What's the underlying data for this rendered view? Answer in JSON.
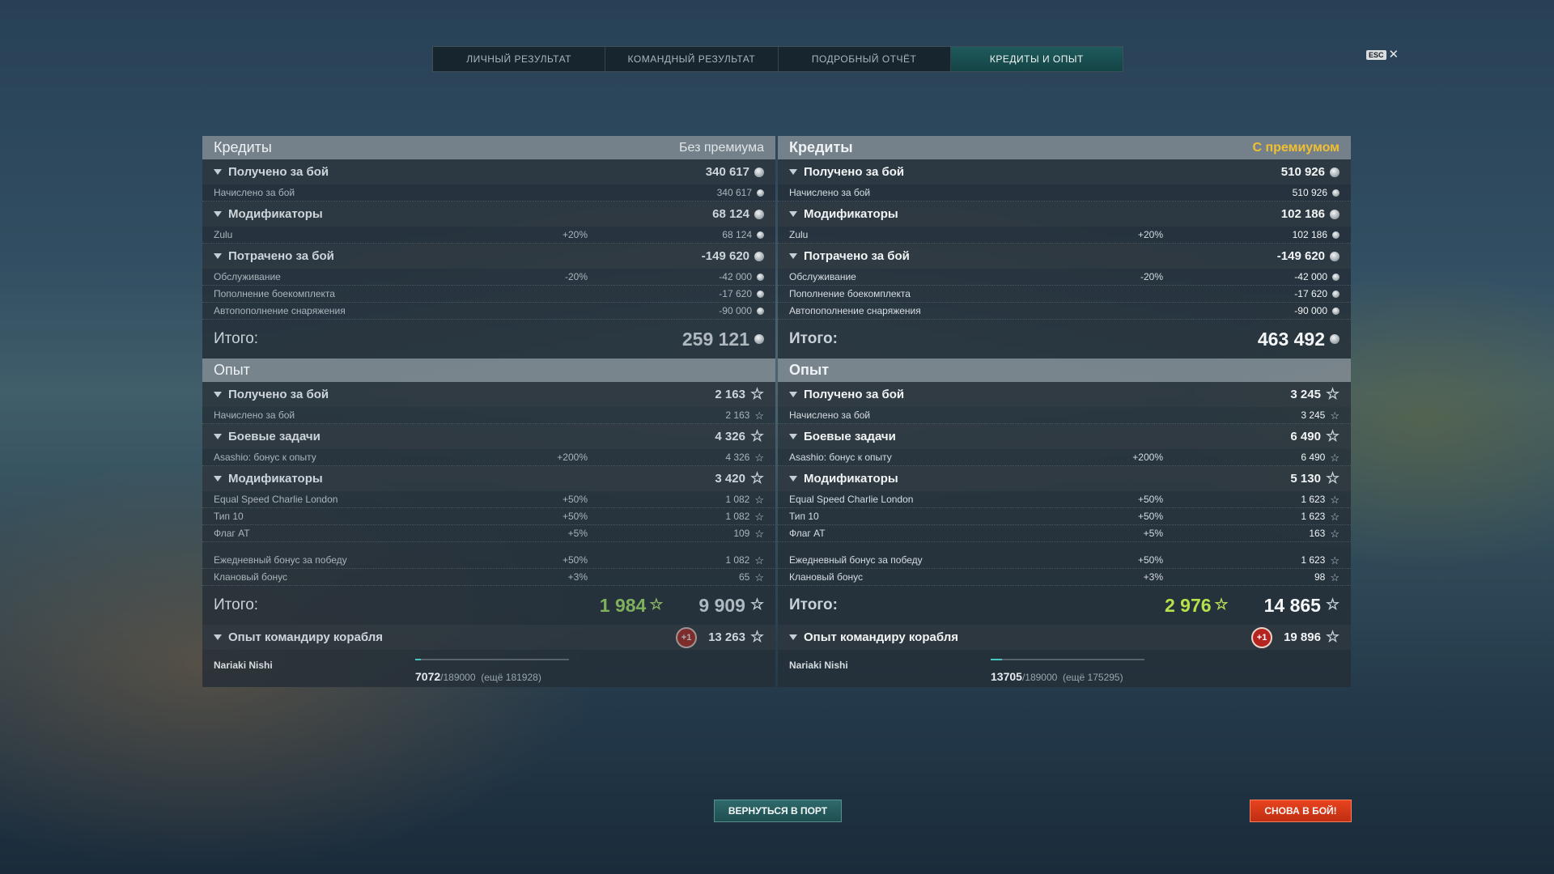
{
  "tabs": [
    {
      "label": "ЛИЧНЫЙ РЕЗУЛЬТАТ"
    },
    {
      "label": "КОМАНДНЫЙ РЕЗУЛЬТАТ"
    },
    {
      "label": "ПОДРОБНЫЙ ОТЧЁТ"
    },
    {
      "label": "КРЕДИТЫ И ОПЫТ"
    }
  ],
  "esc": {
    "key": "ESC",
    "close": "✕"
  },
  "left": {
    "credits": {
      "title": "Кредиты",
      "tag": "Без премиума",
      "earned": {
        "label": "Получено за бой",
        "value": "340 617",
        "items": [
          {
            "label": "Начислено за бой",
            "value": "340 617"
          }
        ]
      },
      "mods": {
        "label": "Модификаторы",
        "value": "68 124",
        "items": [
          {
            "label": "Zulu",
            "pct": "+20%",
            "value": "68 124"
          }
        ]
      },
      "spent": {
        "label": "Потрачено за бой",
        "value": "-149 620",
        "items": [
          {
            "label": "Обслуживание",
            "pct": "-20%",
            "value": "-42 000"
          },
          {
            "label": "Пополнение боекомплекта",
            "value": "-17 620"
          },
          {
            "label": "Автопополнение снаряжения",
            "value": "-90 000"
          }
        ]
      },
      "total_label": "Итого:",
      "total": "259 121"
    },
    "xp": {
      "title": "Опыт",
      "earned": {
        "label": "Получено за бой",
        "value": "2 163",
        "items": [
          {
            "label": "Начислено за бой",
            "value": "2 163"
          }
        ]
      },
      "tasks": {
        "label": "Боевые задачи",
        "value": "4 326",
        "items": [
          {
            "label": "Asashio: бонус к опыту",
            "pct": "+200%",
            "value": "4 326"
          }
        ]
      },
      "mods": {
        "label": "Модификаторы",
        "value": "3 420",
        "items": [
          {
            "label": "Equal Speed Charlie London",
            "pct": "+50%",
            "value": "1 082"
          },
          {
            "label": "Тип 10",
            "pct": "+50%",
            "value": "1 082"
          },
          {
            "label": "Флаг AT",
            "pct": "+5%",
            "value": "109"
          },
          {
            "label": "Ежедневный бонус за победу",
            "pct": "+50%",
            "value": "1 082"
          },
          {
            "label": "Клановый бонус",
            "pct": "+3%",
            "value": "65"
          }
        ]
      },
      "total_label": "Итого:",
      "free": "1 984",
      "total": "9 909"
    },
    "commander": {
      "label": "Опыт командиру корабля",
      "badge": "+1",
      "value": "13 263",
      "name": "Nariaki Nishi",
      "current": "7072",
      "max": "/189000",
      "remaining": "(ещё 181928)",
      "progress": 0.037
    }
  },
  "right": {
    "credits": {
      "title": "Кредиты",
      "tag": "С премиумом",
      "earned": {
        "label": "Получено за бой",
        "value": "510 926",
        "items": [
          {
            "label": "Начислено за бой",
            "value": "510 926"
          }
        ]
      },
      "mods": {
        "label": "Модификаторы",
        "value": "102 186",
        "items": [
          {
            "label": "Zulu",
            "pct": "+20%",
            "value": "102 186"
          }
        ]
      },
      "spent": {
        "label": "Потрачено за бой",
        "value": "-149 620",
        "items": [
          {
            "label": "Обслуживание",
            "pct": "-20%",
            "value": "-42 000"
          },
          {
            "label": "Пополнение боекомплекта",
            "value": "-17 620"
          },
          {
            "label": "Автопополнение снаряжения",
            "value": "-90 000"
          }
        ]
      },
      "total_label": "Итого:",
      "total": "463 492"
    },
    "xp": {
      "title": "Опыт",
      "earned": {
        "label": "Получено за бой",
        "value": "3 245",
        "items": [
          {
            "label": "Начислено за бой",
            "value": "3 245"
          }
        ]
      },
      "tasks": {
        "label": "Боевые задачи",
        "value": "6 490",
        "items": [
          {
            "label": "Asashio: бонус к опыту",
            "pct": "+200%",
            "value": "6 490"
          }
        ]
      },
      "mods": {
        "label": "Модификаторы",
        "value": "5 130",
        "items": [
          {
            "label": "Equal Speed Charlie London",
            "pct": "+50%",
            "value": "1 623"
          },
          {
            "label": "Тип 10",
            "pct": "+50%",
            "value": "1 623"
          },
          {
            "label": "Флаг AT",
            "pct": "+5%",
            "value": "163"
          },
          {
            "label": "Ежедневный бонус за победу",
            "pct": "+50%",
            "value": "1 623"
          },
          {
            "label": "Клановый бонус",
            "pct": "+3%",
            "value": "98"
          }
        ]
      },
      "total_label": "Итого:",
      "free": "2 976",
      "total": "14 865"
    },
    "commander": {
      "label": "Опыт командиру корабля",
      "badge": "+1",
      "value": "19 896",
      "name": "Nariaki Nishi",
      "current": "13705",
      "max": "/189000",
      "remaining": "(ещё 175295)",
      "progress": 0.073
    }
  },
  "buttons": {
    "port": "ВЕРНУТЬСЯ В ПОРТ",
    "battle": "СНОВА В БОЙ!"
  },
  "colors": {
    "premium": "#f0c030",
    "free_xp_left": "#7fb05e",
    "free_xp_right": "#b5e14b",
    "battle_button": "#d9381a",
    "active_tab": "#1e5a5c"
  }
}
